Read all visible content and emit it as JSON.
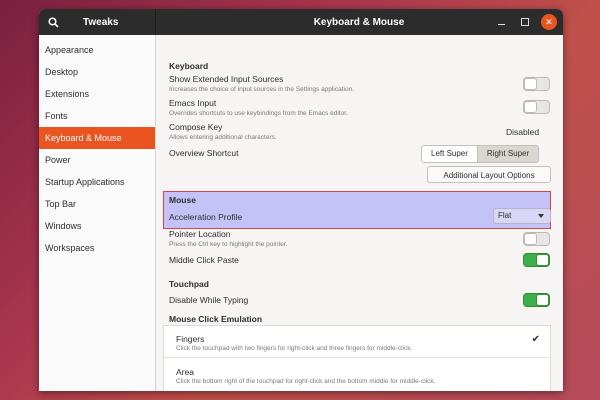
{
  "app_title": "Tweaks",
  "window_title": "Keyboard & Mouse",
  "sidebar": {
    "items": [
      {
        "label": "Appearance"
      },
      {
        "label": "Desktop"
      },
      {
        "label": "Extensions"
      },
      {
        "label": "Fonts"
      },
      {
        "label": "Keyboard & Mouse",
        "active": true
      },
      {
        "label": "Power"
      },
      {
        "label": "Startup Applications"
      },
      {
        "label": "Top Bar"
      },
      {
        "label": "Windows"
      },
      {
        "label": "Workspaces"
      }
    ]
  },
  "keyboard": {
    "title": "Keyboard",
    "extended_sources": {
      "label": "Show Extended Input Sources",
      "desc": "Increases the choice of input sources in the Settings application.",
      "enabled": false
    },
    "emacs": {
      "label": "Emacs Input",
      "desc": "Overrides shortcuts to use keybindings from the Emacs editor.",
      "enabled": false
    },
    "compose": {
      "label": "Compose Key",
      "desc": "Allows entering additional characters.",
      "value": "Disabled"
    },
    "overview": {
      "label": "Overview Shortcut",
      "options": [
        "Left Super",
        "Right Super"
      ],
      "selected": "Right Super"
    },
    "additional_layout_button": "Additional Layout Options"
  },
  "mouse": {
    "title": "Mouse",
    "acceleration": {
      "label": "Acceleration Profile",
      "value": "Flat"
    },
    "pointer_location": {
      "label": "Pointer Location",
      "desc": "Press the Ctrl key to highlight the pointer.",
      "enabled": false
    },
    "middle_click": {
      "label": "Middle Click Paste",
      "enabled": true
    }
  },
  "touchpad": {
    "title": "Touchpad",
    "disable_typing": {
      "label": "Disable While Typing",
      "enabled": true
    }
  },
  "click_emulation": {
    "title": "Mouse Click Emulation",
    "options": [
      {
        "label": "Fingers",
        "desc": "Click the touchpad with two fingers for right-click and three fingers for middle-click.",
        "checked": true
      },
      {
        "label": "Area",
        "desc": "Click the bottom right of the touchpad for right-click and the bottom middle for middle-click.",
        "checked": false
      }
    ]
  },
  "colors": {
    "accent": "#e95420",
    "toggle_on": "#3daf46",
    "highlight": "#c4c2f7",
    "highlight_border": "#d9434a"
  }
}
